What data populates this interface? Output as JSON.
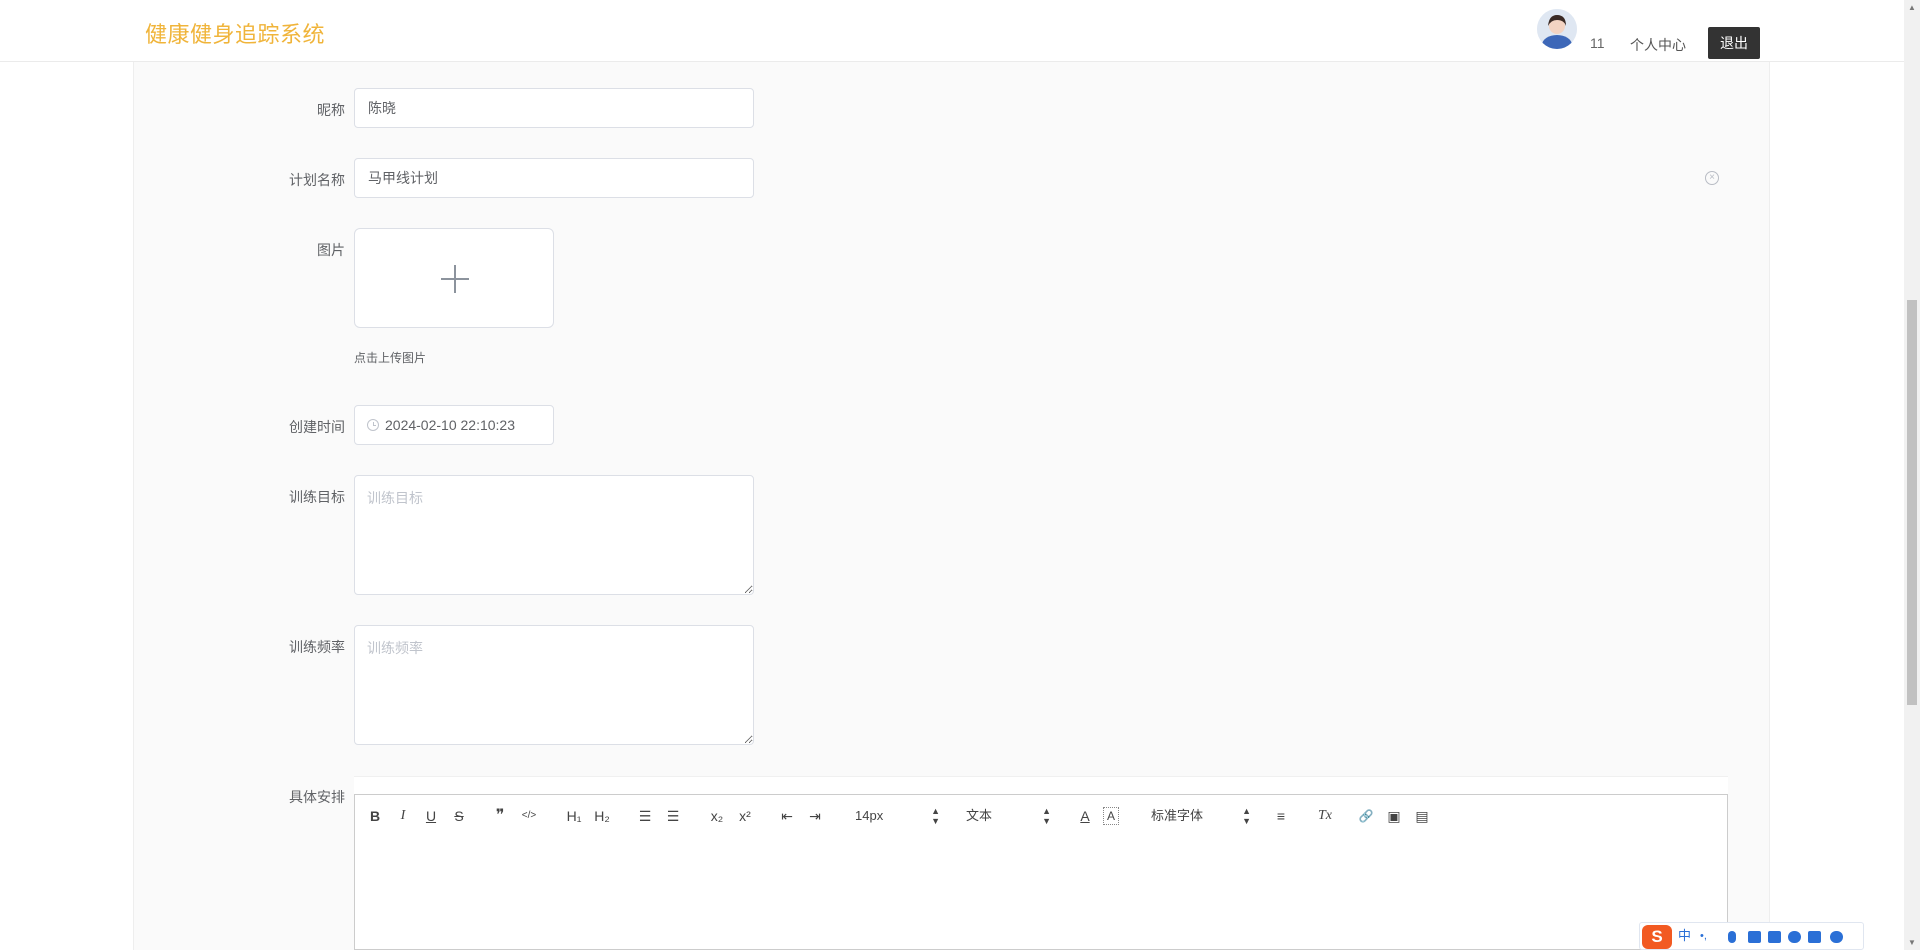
{
  "header": {
    "brand": "健康健身追踪系统",
    "username": "11",
    "profile_label": "个人中心",
    "logout_label": "退出"
  },
  "form": {
    "nickname": {
      "label": "昵称",
      "value": "陈晓"
    },
    "plan_name": {
      "label": "计划名称",
      "value": "马甲线计划"
    },
    "image": {
      "label": "图片",
      "hint": "点击上传图片"
    },
    "created_time": {
      "label": "创建时间",
      "value": "2024-02-10 22:10:23"
    },
    "goal": {
      "label": "训练目标",
      "placeholder": "训练目标"
    },
    "frequency": {
      "label": "训练频率",
      "placeholder": "训练频率"
    },
    "schedule": {
      "label": "具体安排"
    }
  },
  "editor": {
    "size_value": "14px",
    "header_value": "文本",
    "font_value": "标准字体",
    "buttons": {
      "bold": "B",
      "italic": "I",
      "underline": "U",
      "strike": "S",
      "blockquote": "❞",
      "code": "</>",
      "h1": "H₁",
      "h2": "H₂",
      "ordered_list": "☰",
      "bullet_list": "☰",
      "subscript": "x₂",
      "superscript": "x²",
      "outdent": "⇤",
      "indent": "⇥",
      "color": "A",
      "background": "A",
      "align": "≡",
      "clean": "Tx",
      "link": "🔗",
      "image": "▣",
      "video": "▤"
    }
  },
  "ime": {
    "logo": "S",
    "lang": "中",
    "punct": "•,"
  },
  "colors": {
    "brand": "#f0b43a",
    "logout_bg": "#333333",
    "ime_logo": "#f25a22",
    "ime_icons": "#2a6fd6"
  }
}
